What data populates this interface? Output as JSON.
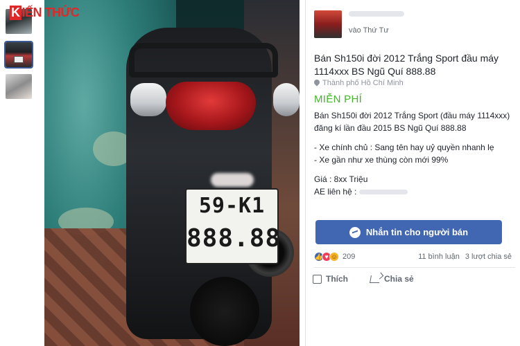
{
  "brand": {
    "logo_letter": "K",
    "logo_text": "IẾN THỨC"
  },
  "photo": {
    "plate_line1": "59-K1",
    "plate_line2": "888.88"
  },
  "listing": {
    "seller_time": "vào Thứ Tư",
    "title": "Bán Sh150i đời 2012 Trắng Sport đầu máy 1114xxx BS Ngũ Quí 888.88",
    "location": "Thành phố Hồ Chí Minh",
    "price": "MIỄN PHÍ",
    "desc": {
      "line1": "Bán Sh150i đời 2012 Trắng Sport (đầu máy 1114xxx) đăng kí lần đầu 2015 BS Ngũ Quí 888.88",
      "bullet1": "- Xe chính chủ : Sang tên hay uỷ quyền nhanh lẹ",
      "bullet2": "- Xe gần như xe thùng còn mới 99%",
      "price_line": "Giá : 8xx Triệu",
      "contact_line": "AE liên hệ :"
    },
    "message_button": "Nhắn tin cho người bán",
    "reaction_count": "209",
    "comments": "11 bình luận",
    "shares": "3 lượt chia sẻ",
    "like_label": "Thích",
    "share_label": "Chia sẻ"
  },
  "icons": {
    "location": "map-pin-icon",
    "messenger": "messenger-icon",
    "like": "thumbs-up-icon",
    "share": "share-arrow-icon"
  },
  "colors": {
    "price_green": "#42b72a",
    "button_blue": "#4267b2",
    "logo_red": "#e02828"
  }
}
